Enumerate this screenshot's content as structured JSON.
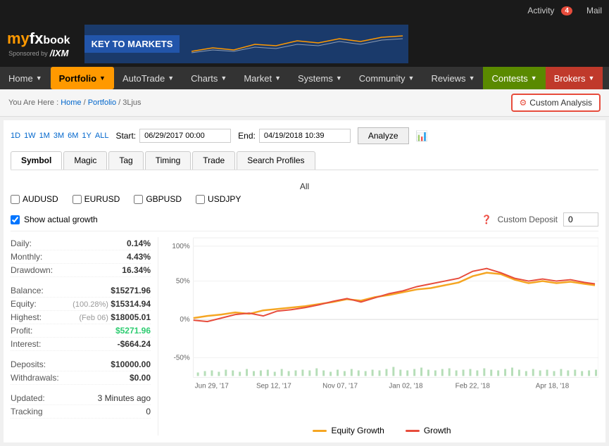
{
  "topbar": {
    "activity_label": "Activity",
    "activity_count": "4",
    "mail_label": "Mail"
  },
  "logo": {
    "brand_my": "my",
    "brand_fx": "fx",
    "brand_book": "book",
    "sponsored_by": "Sponsored by",
    "ixm": "IXM"
  },
  "banner": {
    "text": "KEY TO MARKETS"
  },
  "nav": {
    "items": [
      {
        "label": "Home",
        "caret": true,
        "active": false
      },
      {
        "label": "Portfolio",
        "caret": true,
        "active": true
      },
      {
        "label": "AutoTrade",
        "caret": true,
        "active": false
      },
      {
        "label": "Charts",
        "caret": true,
        "active": false
      },
      {
        "label": "Market",
        "caret": true,
        "active": false
      },
      {
        "label": "Systems",
        "caret": true,
        "active": false
      },
      {
        "label": "Community",
        "caret": true,
        "active": false
      },
      {
        "label": "Reviews",
        "caret": true,
        "active": false
      },
      {
        "label": "Contests",
        "caret": true,
        "active": false,
        "green": true
      },
      {
        "label": "Brokers",
        "caret": true,
        "active": false,
        "brokers": true
      }
    ]
  },
  "breadcrumb": {
    "text": "You Are Here :",
    "home": "Home",
    "portfolio": "Portfolio",
    "current": "3Ljus"
  },
  "custom_analysis": {
    "label": "Custom Analysis"
  },
  "date_range": {
    "shortcuts": [
      "1D",
      "1W",
      "1M",
      "3M",
      "6M",
      "1Y",
      "ALL"
    ],
    "start_label": "Start:",
    "start_value": "06/29/2017 00:00",
    "end_label": "End:",
    "end_value": "04/19/2018 10:39",
    "analyze_btn": "Analyze"
  },
  "tabs": {
    "items": [
      "Symbol",
      "Magic",
      "Tag",
      "Timing",
      "Trade",
      "Search Profiles"
    ],
    "active": "Symbol"
  },
  "symbols": {
    "all_label": "All",
    "items": [
      "AUDUSD",
      "EURUSD",
      "GBPUSD",
      "USDJPY"
    ]
  },
  "growth": {
    "show_label": "Show actual growth",
    "custom_deposit_label": "Custom Deposit",
    "custom_deposit_value": "0"
  },
  "stats": {
    "sections": [
      {
        "rows": [
          {
            "label": "Daily:",
            "value": "0.14%",
            "color": "normal"
          },
          {
            "label": "Monthly:",
            "value": "4.43%",
            "color": "normal"
          },
          {
            "label": "Drawdown:",
            "value": "16.34%",
            "color": "normal"
          }
        ]
      },
      {
        "rows": [
          {
            "label": "Balance:",
            "value": "$15271.96",
            "color": "normal"
          },
          {
            "label": "Equity:",
            "value": "$15314.94",
            "sub": "(100.28%)",
            "color": "normal"
          },
          {
            "label": "Highest:",
            "value": "$18005.01",
            "sub": "(Feb 06)",
            "color": "normal"
          },
          {
            "label": "Profit:",
            "value": "$5271.96",
            "color": "green"
          },
          {
            "label": "Interest:",
            "value": "-$664.24",
            "color": "normal"
          }
        ]
      },
      {
        "rows": [
          {
            "label": "Deposits:",
            "value": "$10000.00",
            "color": "normal"
          },
          {
            "label": "Withdrawals:",
            "value": "$0.00",
            "color": "normal"
          }
        ]
      },
      {
        "rows": [
          {
            "label": "Updated:",
            "value": "3 Minutes ago",
            "color": "normal"
          },
          {
            "label": "Tracking",
            "value": "0",
            "color": "normal"
          }
        ]
      }
    ]
  },
  "chart": {
    "y_labels": [
      "100%",
      "50%",
      "0%",
      "-50%"
    ],
    "x_labels": [
      "Jun 29, '17",
      "Sep 12, '17",
      "Nov 07, '17",
      "Jan 02, '18",
      "Feb 22, '18",
      "Apr 18, '18"
    ],
    "legend": {
      "equity_growth": "Equity Growth",
      "growth": "Growth"
    }
  }
}
